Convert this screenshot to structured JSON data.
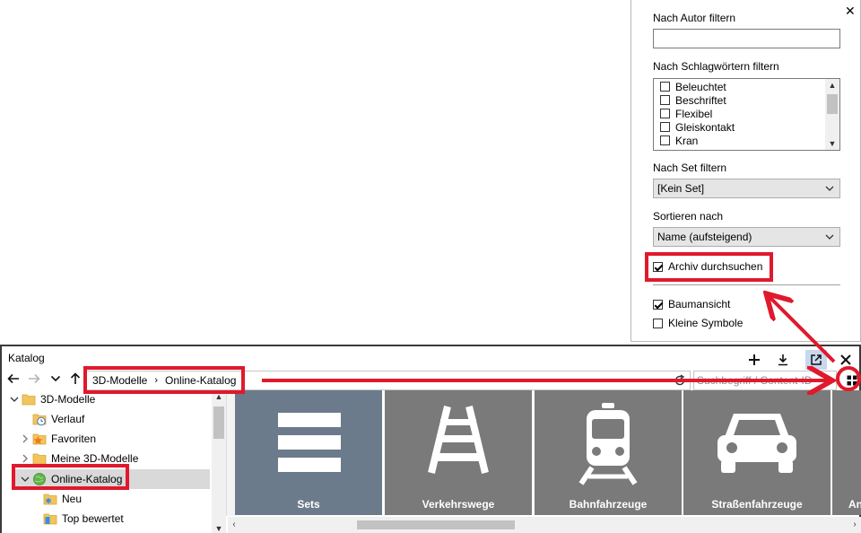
{
  "filter_panel": {
    "close_glyph": "✕",
    "author_label": "Nach Autor filtern",
    "author_value": "",
    "keywords_label": "Nach Schlagwörtern filtern",
    "keywords": [
      "Beleuchtet",
      "Beschriftet",
      "Flexibel",
      "Gleiskontakt",
      "Kran"
    ],
    "set_label": "Nach Set filtern",
    "set_value": "[Kein Set]",
    "sort_label": "Sortieren nach",
    "sort_value": "Name (aufsteigend)",
    "archive_label": "Archiv durchsuchen",
    "archive_checked": true,
    "tree_view_label": "Baumansicht",
    "tree_view_checked": true,
    "small_icons_label": "Kleine Symbole",
    "small_icons_checked": false
  },
  "catalog": {
    "title": "Katalog",
    "breadcrumb": [
      "3D-Modelle",
      "Online-Katalog"
    ],
    "breadcrumb_separator": "›",
    "search_placeholder": "Suchbegriff / Content-ID",
    "search_value": "",
    "tree": [
      {
        "label": "3D-Modelle",
        "level": 0,
        "expander": "expanded",
        "icon": "folder-icon"
      },
      {
        "label": "Verlauf",
        "level": 1,
        "expander": "none",
        "icon": "history-icon"
      },
      {
        "label": "Favoriten",
        "level": 1,
        "expander": "collapsed",
        "icon": "star-folder-icon"
      },
      {
        "label": "Meine 3D-Modelle",
        "level": 1,
        "expander": "collapsed",
        "icon": "folder-icon"
      },
      {
        "label": "Online-Katalog",
        "level": 1,
        "expander": "expanded",
        "icon": "globe-icon",
        "selected": true
      },
      {
        "label": "Neu",
        "level": 2,
        "expander": "none",
        "icon": "new-badge-icon"
      },
      {
        "label": "Top bewertet",
        "level": 2,
        "expander": "none",
        "icon": "top-rated-icon"
      }
    ],
    "tiles": [
      {
        "label": "Sets",
        "icon": "sets-icon",
        "active": true
      },
      {
        "label": "Verkehrswege",
        "icon": "track-icon"
      },
      {
        "label": "Bahnfahrzeuge",
        "icon": "train-icon"
      },
      {
        "label": "Straßenfahrzeuge",
        "icon": "car-icon"
      },
      {
        "label": "An",
        "icon": "none"
      }
    ]
  },
  "colors": {
    "annotation": "#e0192c",
    "tile_bg": "#7a7a7a",
    "tile_active_bg": "#6b7b8b",
    "selection_bg": "#d9d9d9"
  }
}
